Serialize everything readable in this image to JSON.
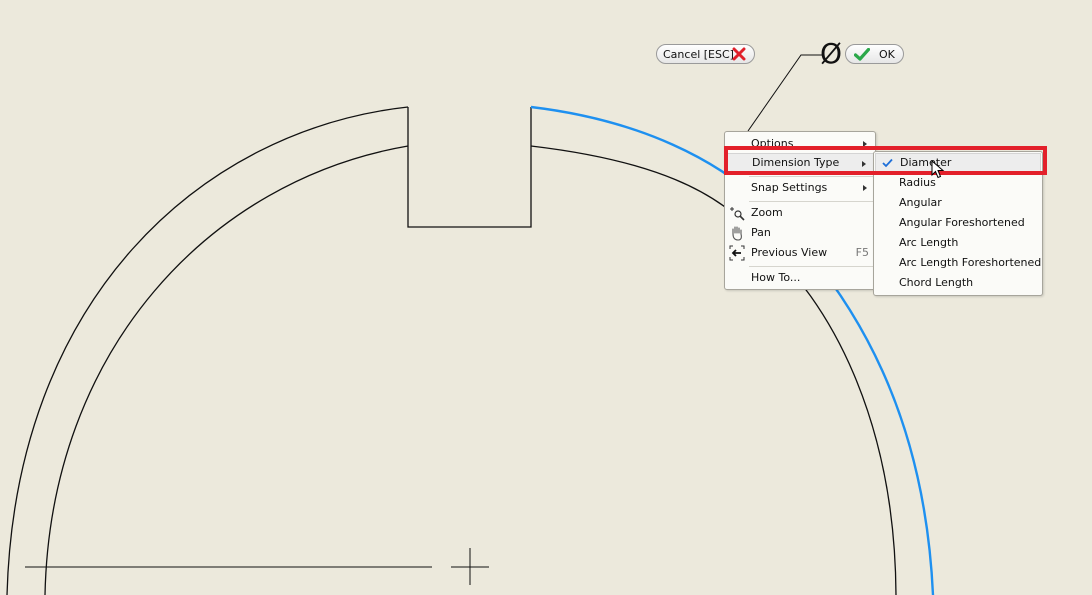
{
  "toolbar": {
    "cancel_label": "Cancel [ESC]",
    "ok_label": "OK",
    "dimension_symbol": "Ø"
  },
  "context_menu": {
    "items": [
      {
        "label": "Options",
        "has_submenu": true
      },
      {
        "label": "Dimension Type",
        "has_submenu": true,
        "active": true
      },
      {
        "label": "Snap Settings",
        "has_submenu": true
      },
      {
        "label": "Zoom",
        "icon": "zoom-icon"
      },
      {
        "label": "Pan",
        "icon": "pan-hand-icon"
      },
      {
        "label": "Previous View",
        "shortcut": "F5",
        "icon": "previous-view-icon"
      },
      {
        "label": "How To..."
      }
    ]
  },
  "dimension_type_submenu": {
    "selected": "Diameter",
    "items": [
      {
        "label": "Diameter",
        "checked": true
      },
      {
        "label": "Radius"
      },
      {
        "label": "Angular"
      },
      {
        "label": "Angular Foreshortened"
      },
      {
        "label": "Arc Length"
      },
      {
        "label": "Arc Length Foreshortened"
      },
      {
        "label": "Chord Length"
      }
    ]
  },
  "colors": {
    "background": "#ECE9DC",
    "geometry_line": "#111111",
    "selected_arc": "#1E90F0",
    "highlight": "#E3202A",
    "cancel_x": "#E0202A",
    "ok_check": "#2BA84A"
  }
}
